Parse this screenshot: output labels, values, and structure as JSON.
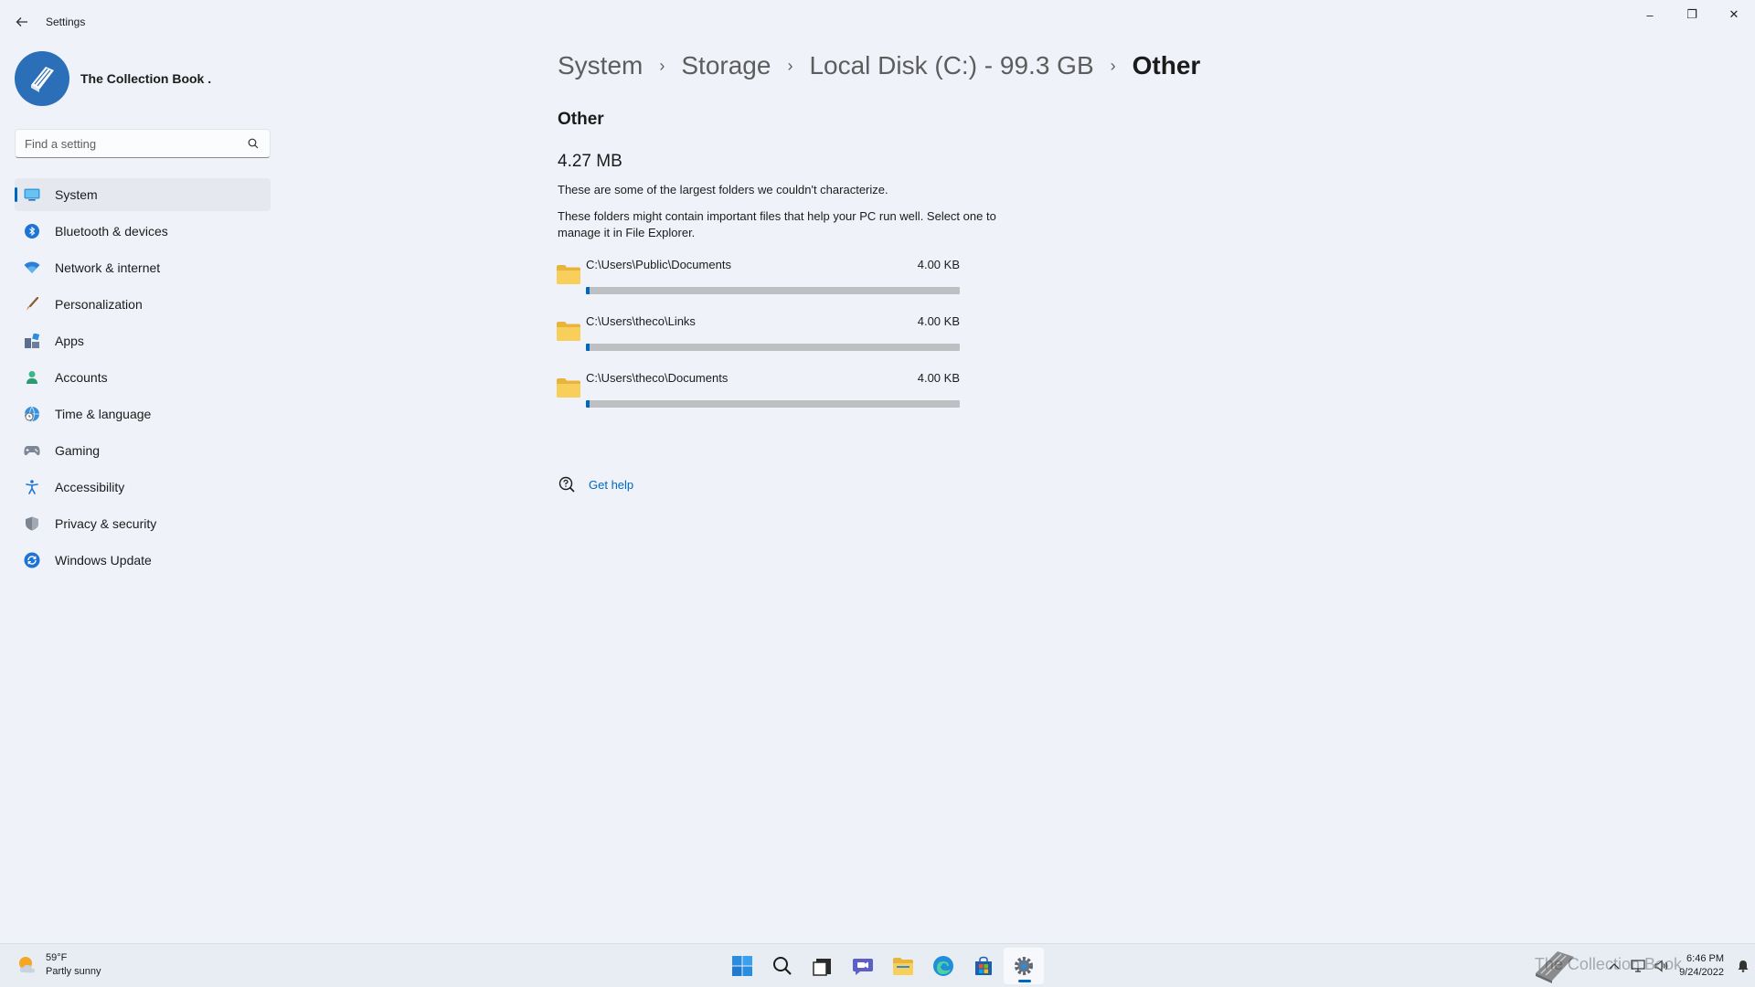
{
  "window": {
    "app_title": "Settings",
    "controls": {
      "minimize": "–",
      "maximize": "❐",
      "close": "✕"
    }
  },
  "profile": {
    "name": "The Collection Book ."
  },
  "search": {
    "placeholder": "Find a setting"
  },
  "nav": {
    "items": [
      {
        "label": "System",
        "icon": "system-icon",
        "active": true
      },
      {
        "label": "Bluetooth & devices",
        "icon": "bluetooth-icon"
      },
      {
        "label": "Network & internet",
        "icon": "wifi-icon"
      },
      {
        "label": "Personalization",
        "icon": "brush-icon"
      },
      {
        "label": "Apps",
        "icon": "apps-icon"
      },
      {
        "label": "Accounts",
        "icon": "person-icon"
      },
      {
        "label": "Time & language",
        "icon": "globe-clock-icon"
      },
      {
        "label": "Gaming",
        "icon": "gamepad-icon"
      },
      {
        "label": "Accessibility",
        "icon": "accessibility-icon"
      },
      {
        "label": "Privacy & security",
        "icon": "shield-icon"
      },
      {
        "label": "Windows Update",
        "icon": "update-icon"
      }
    ]
  },
  "breadcrumb": {
    "items": [
      "System",
      "Storage",
      "Local Disk (C:) - 99.3 GB",
      "Other"
    ],
    "separator": "›"
  },
  "content": {
    "section_title": "Other",
    "total_size": "4.27 MB",
    "description_1": "These are some of the largest folders we couldn't characterize.",
    "description_2": "These folders might contain important files that help your PC run well. Select one to manage it in File Explorer.",
    "folders": [
      {
        "path": "C:\\Users\\Public\\Documents",
        "size": "4.00 KB",
        "fill": 0.01
      },
      {
        "path": "C:\\Users\\theco\\Links",
        "size": "4.00 KB",
        "fill": 0.01
      },
      {
        "path": "C:\\Users\\theco\\Documents",
        "size": "4.00 KB",
        "fill": 0.01
      }
    ],
    "help_label": "Get help"
  },
  "taskbar": {
    "weather": {
      "temp": "59°F",
      "condition": "Partly sunny"
    },
    "apps": [
      "start-icon",
      "search-icon",
      "task-view-icon",
      "chat-icon",
      "file-explorer-icon",
      "edge-icon",
      "store-icon",
      "settings-icon"
    ],
    "watermark": "The Collection Book",
    "clock": {
      "time": "6:46 PM",
      "date": "9/24/2022"
    }
  },
  "colors": {
    "accent": "#0067c0",
    "background": "#eff3f9",
    "folder": "#f5c84c"
  }
}
